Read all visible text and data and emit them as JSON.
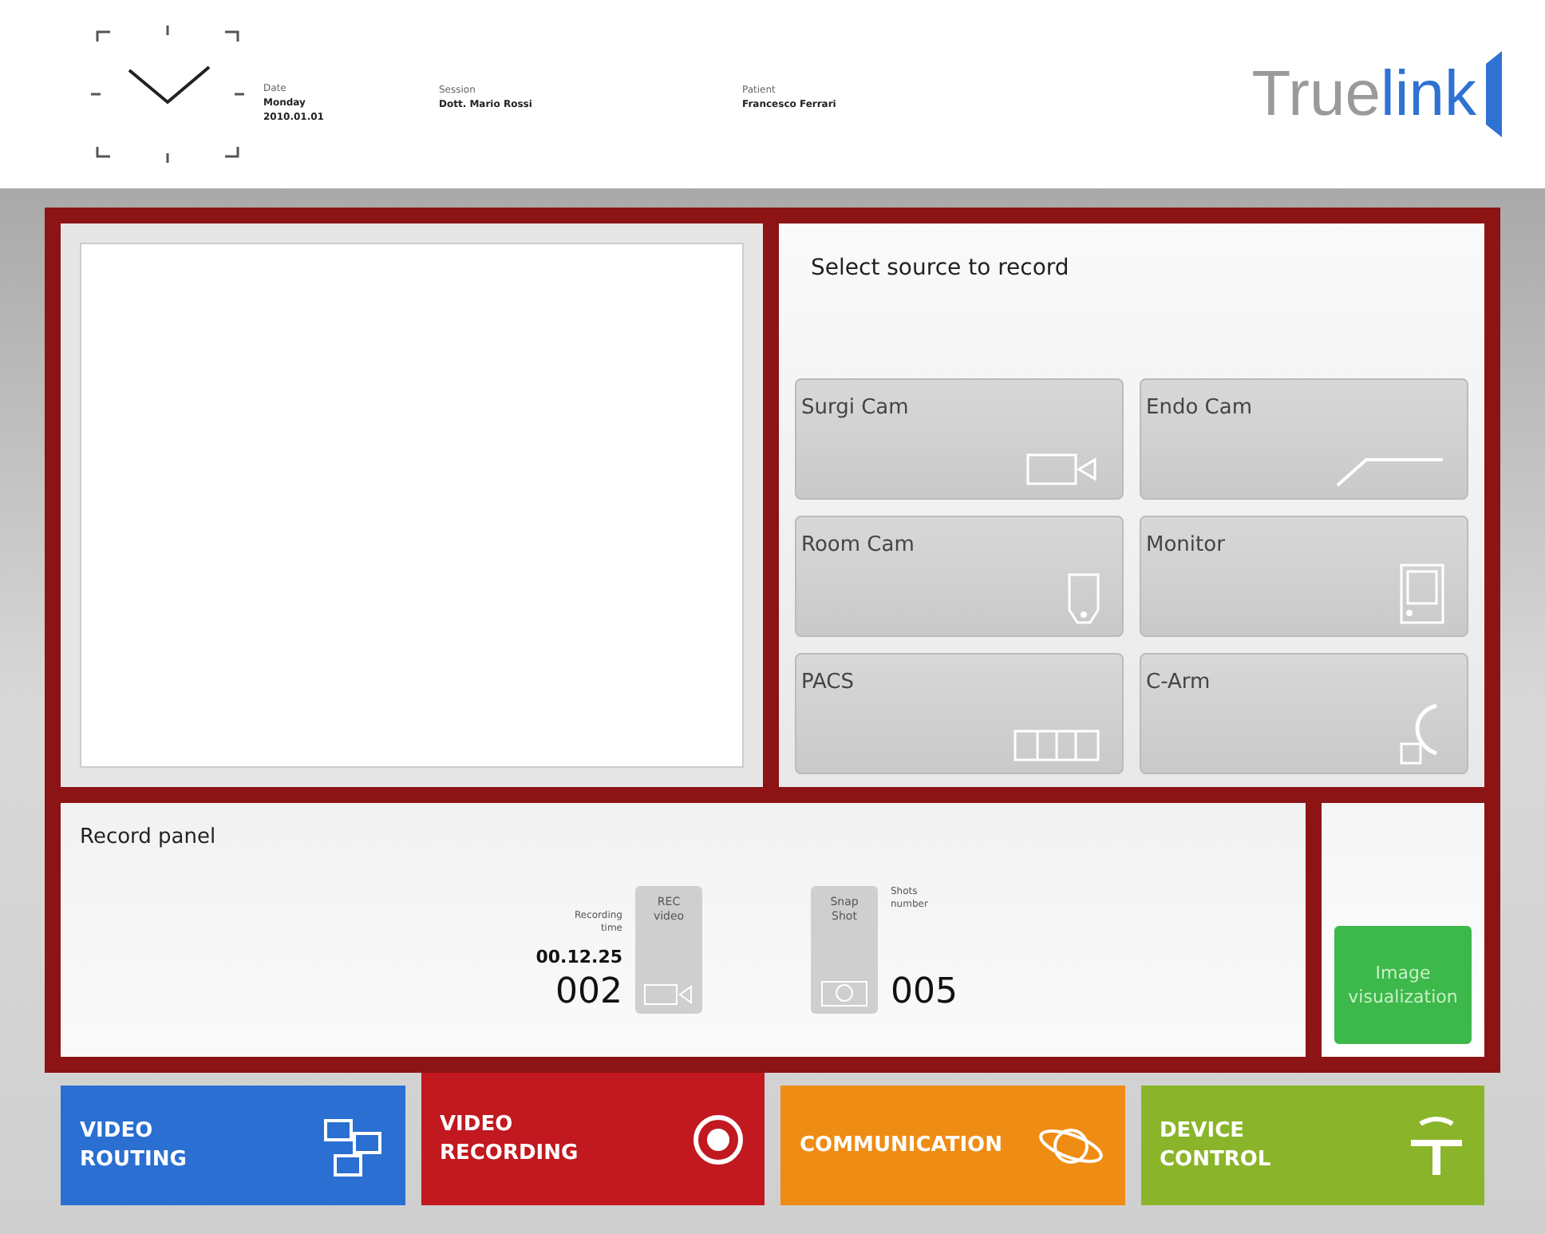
{
  "header": {
    "date_label": "Date",
    "date_day": "Monday",
    "date_value": "2010.01.01",
    "session_label": "Session",
    "session_value": "Dott. Mario Rossi",
    "patient_label": "Patient",
    "patient_value": "Francesco Ferrari",
    "logo_light": "True",
    "logo_bold": "link"
  },
  "source_panel": {
    "title": "Select  source to record",
    "sources": [
      {
        "label": "Surgi Cam",
        "kind": "camera"
      },
      {
        "label": "Endo Cam",
        "kind": "endoscope"
      },
      {
        "label": "Room Cam",
        "kind": "roomcam"
      },
      {
        "label": "Monitor",
        "kind": "monitor"
      },
      {
        "label": "PACS",
        "kind": "pacs"
      },
      {
        "label": "C-Arm",
        "kind": "carm"
      }
    ]
  },
  "record_panel": {
    "title": "Record panel",
    "recording_label_1": "Recording",
    "recording_label_2": "time",
    "recording_time": "00.12.25",
    "recording_count": "002",
    "rec_button_1": "REC",
    "rec_button_2": "video",
    "snap_button_1": "Snap",
    "snap_button_2": "Shot",
    "shots_label_1": "Shots",
    "shots_label_2": "number",
    "shots_count": "005"
  },
  "image_button": {
    "line_1": "Image",
    "line_2": "visualization"
  },
  "nav": [
    {
      "line_1": "VIDEO",
      "line_2": "ROUTING",
      "kind": "routing",
      "color": "#2a6fd1",
      "selected": false
    },
    {
      "line_1": "VIDEO",
      "line_2": "RECORDING",
      "kind": "record",
      "color": "#c2181f",
      "selected": true
    },
    {
      "line_1": "COMMUNICATION",
      "kind": "planet",
      "color": "#ef8c14",
      "selected": false
    },
    {
      "line_1": "DEVICE",
      "line_2": "CONTROL",
      "kind": "lamp",
      "color": "#8ab52a",
      "selected": false
    }
  ]
}
